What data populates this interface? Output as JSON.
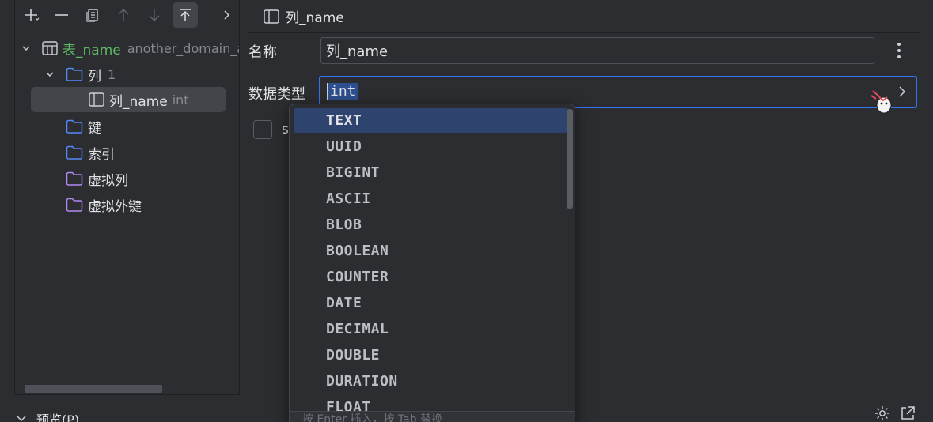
{
  "toolbar": {
    "buttons": [
      "add-icon",
      "remove-icon",
      "copy-icon",
      "move-up-icon",
      "move-down-icon",
      "move-to-top-icon",
      "expand-icon"
    ]
  },
  "tree": {
    "table": {
      "name": "表_name",
      "extra": "another_domain_a"
    },
    "columns_folder": {
      "label": "列",
      "count": "1"
    },
    "column": {
      "name": "列_name",
      "type": "int"
    },
    "keys_folder": "键",
    "indexes_folder": "索引",
    "virtual_columns_folder": "虚拟列",
    "virtual_fk_folder": "虚拟外键"
  },
  "editor": {
    "title": "列_name",
    "name_label": "名称",
    "name_value": "列_name",
    "type_label": "数据类型",
    "type_value": "int",
    "checkbox_label": "s"
  },
  "dropdown": {
    "options": [
      "TEXT",
      "UUID",
      "BIGINT",
      "ASCII",
      "BLOB",
      "BOOLEAN",
      "COUNTER",
      "DATE",
      "DECIMAL",
      "DOUBLE",
      "DURATION",
      "FLOAT"
    ],
    "selected": "TEXT",
    "footer": "按 Enter 插入，按 Tab 替换"
  },
  "bottom": {
    "preview_label": "预览(P)"
  },
  "colors": {
    "accent": "#3574f0",
    "folder_blue": "#548af7",
    "folder_purple": "#b189f5",
    "table_green": "#5fb865"
  }
}
